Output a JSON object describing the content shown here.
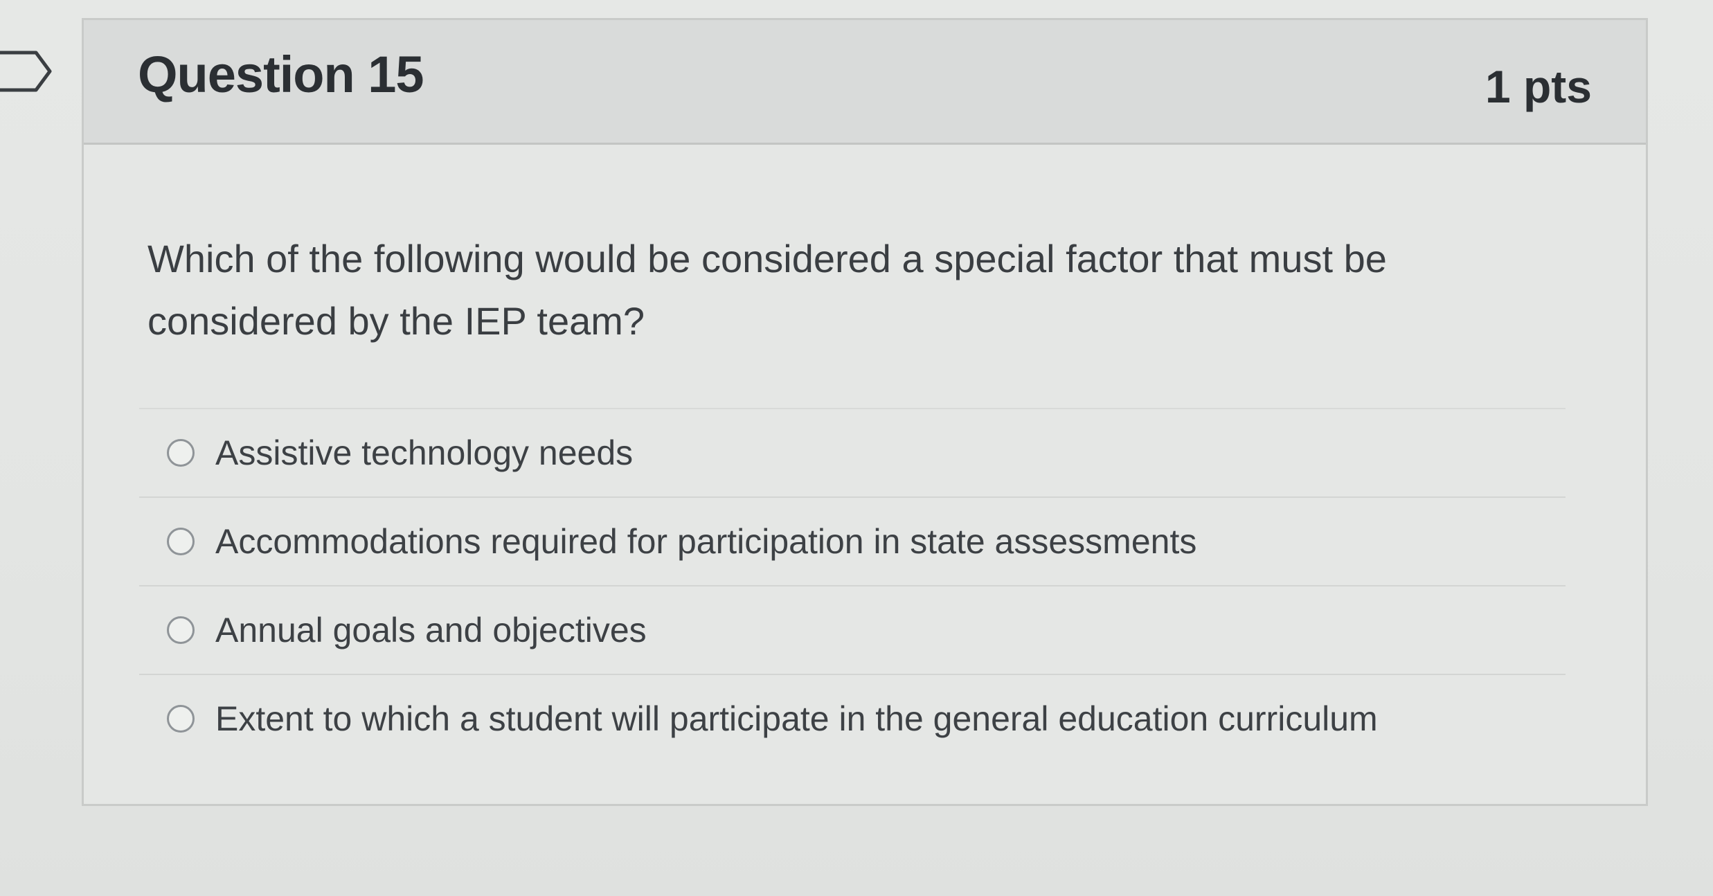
{
  "question": {
    "title": "Question 15",
    "points": "1 pts",
    "text": "Which of the following would be considered a special factor that must be considered by the IEP team?",
    "flag_icon": "flag-outline-icon"
  },
  "answers": [
    {
      "label": "Assistive technology needs",
      "selected": false
    },
    {
      "label": "Accommodations required for participation in state assessments",
      "selected": false
    },
    {
      "label": "Annual goals and objectives",
      "selected": false
    },
    {
      "label": "Extent to which a student will participate in the general education curriculum",
      "selected": false
    }
  ],
  "colors": {
    "header_bg": "#d9dbda",
    "card_bg": "#e5e7e5",
    "border": "#c9cbc9",
    "text": "#2b2f33"
  }
}
